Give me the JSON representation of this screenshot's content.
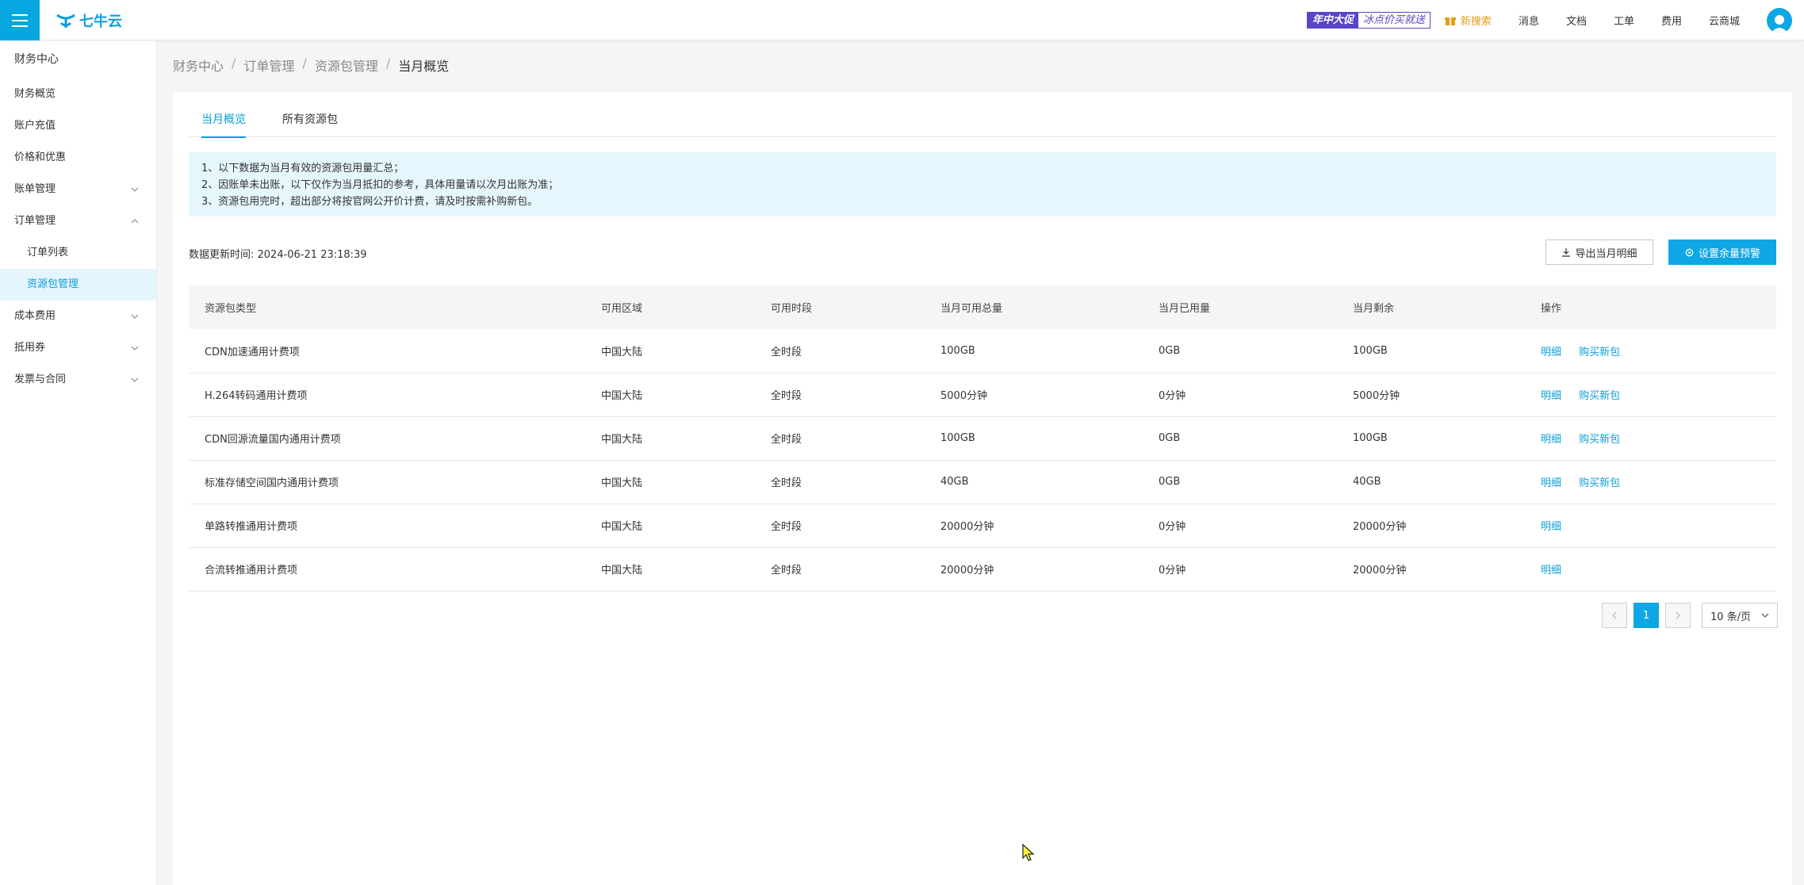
{
  "header": {
    "logo_text": "七牛云",
    "promo_left": "年中大促",
    "promo_right": "冰点价买就送",
    "gift_label": "新搜索",
    "nav": [
      "消息",
      "文档",
      "工单",
      "费用",
      "云商城"
    ]
  },
  "sidebar": {
    "title": "财务中心",
    "items": [
      {
        "label": "财务概览"
      },
      {
        "label": "账户充值"
      },
      {
        "label": "价格和优惠"
      },
      {
        "label": "账单管理"
      },
      {
        "label": "订单管理"
      },
      {
        "label": "订单列表"
      },
      {
        "label": "资源包管理"
      },
      {
        "label": "成本费用"
      },
      {
        "label": "抵用券"
      },
      {
        "label": "发票与合同"
      }
    ]
  },
  "breadcrumb": [
    "财务中心",
    "订单管理",
    "资源包管理",
    "当月概览"
  ],
  "tabs": [
    "当月概览",
    "所有资源包"
  ],
  "notice": [
    "1、以下数据为当月有效的资源包用量汇总；",
    "2、因账单未出账，以下仅作为当月抵扣的参考，具体用量请以次月出账为准；",
    "3、资源包用完时，超出部分将按官网公开价计费，请及时按需补购新包。"
  ],
  "update_time": "数据更新时间: 2024-06-21 23:18:39",
  "buttons": {
    "export": "导出当月明细",
    "alert": "设置余量预警"
  },
  "table": {
    "headers": [
      "资源包类型",
      "可用区域",
      "可用时段",
      "当月可用总量",
      "当月已用量",
      "当月剩余",
      "操作"
    ],
    "rows": [
      {
        "type": "CDN加速通用计费项",
        "region": "中国大陆",
        "period": "全时段",
        "total": "100GB",
        "used": "0GB",
        "remain": "100GB",
        "ops": [
          "明细",
          "购买新包"
        ]
      },
      {
        "type": "H.264转码通用计费项",
        "region": "中国大陆",
        "period": "全时段",
        "total": "5000分钟",
        "used": "0分钟",
        "remain": "5000分钟",
        "ops": [
          "明细",
          "购买新包"
        ]
      },
      {
        "type": "CDN回源流量国内通用计费项",
        "region": "中国大陆",
        "period": "全时段",
        "total": "100GB",
        "used": "0GB",
        "remain": "100GB",
        "ops": [
          "明细",
          "购买新包"
        ]
      },
      {
        "type": "标准存储空间国内通用计费项",
        "region": "中国大陆",
        "period": "全时段",
        "total": "40GB",
        "used": "0GB",
        "remain": "40GB",
        "ops": [
          "明细",
          "购买新包"
        ]
      },
      {
        "type": "单路转推通用计费项",
        "region": "中国大陆",
        "period": "全时段",
        "total": "20000分钟",
        "used": "0分钟",
        "remain": "20000分钟",
        "ops": [
          "明细"
        ]
      },
      {
        "type": "合流转推通用计费项",
        "region": "中国大陆",
        "period": "全时段",
        "total": "20000分钟",
        "used": "0分钟",
        "remain": "20000分钟",
        "ops": [
          "明细"
        ]
      }
    ]
  },
  "pagination": {
    "current": "1",
    "page_size": "10 条/页"
  },
  "colors": {
    "accent": "#0fa6e6",
    "promo": "#5a45c9"
  }
}
